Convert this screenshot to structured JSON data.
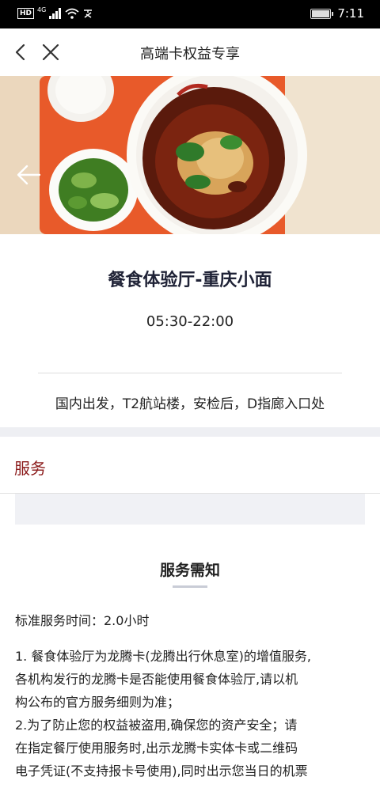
{
  "status_bar": {
    "hd_label": "HD",
    "network_label": "4G",
    "time": "7:11"
  },
  "nav": {
    "title": "高端卡权益专享"
  },
  "banner": {
    "slide_count": 2,
    "active_index": 0
  },
  "venue": {
    "title": "餐食体验厅-重庆小面",
    "hours": "05:30-22:00",
    "location": "国内出发，T2航站楼，安检后，D指廊入口处"
  },
  "tabs": {
    "service_label": "服务"
  },
  "notice": {
    "title": "服务需知",
    "service_time": "标准服务时间：2.0小时",
    "item1_line1": "1. 餐食体验厅为龙腾卡(龙腾出行休息室)的增值服务,",
    "item1_line2": "各机构发行的龙腾卡是否能使用餐食体验厅,请以机",
    "item1_line3": "构公布的官方服务细则为准；",
    "item2_line1": "2.为了防止您的权益被盗用,确保您的资产安全；请",
    "item2_line2": "在指定餐厅使用服务时,出示龙腾卡实体卡或二维码",
    "item2_line3": "电子凭证(不支持报卡号使用),同时出示您当日的机票"
  },
  "colors": {
    "accent_red": "#8b1a1a",
    "dot_active": "#2f6fd0",
    "title_dark": "#1f2236"
  }
}
